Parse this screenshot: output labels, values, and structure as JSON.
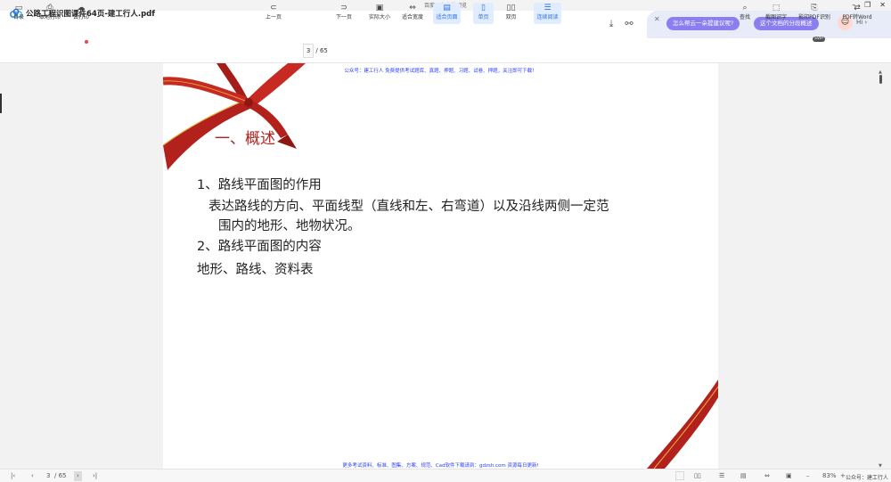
{
  "window": {
    "title": "百度网盘文档预览",
    "controls": [
      "–",
      "❐",
      "✕"
    ]
  },
  "header": {
    "doc_title": "公路工程识图课件64页-建工行人.pdf",
    "download_icon": "download-icon",
    "share_icon": "share-icon"
  },
  "ai": {
    "suggestions": [
      "怎么帮云一朵提建议呢?",
      "这个文档的分段概述"
    ],
    "greeting": "Hi ›"
  },
  "toolbar": {
    "left": [
      {
        "label": "目录",
        "icon": "▭"
      },
      {
        "label": "本地打印",
        "icon": "⎙"
      },
      {
        "label": "云打印",
        "icon": "☁"
      }
    ],
    "prev": "上一页",
    "next": "下一页",
    "page_current": "3",
    "page_total": "/ 65",
    "modes": [
      {
        "label": "实际大小",
        "icon": "▣"
      },
      {
        "label": "适合宽度",
        "icon": "⇔"
      },
      {
        "label": "适合页面",
        "icon": "▤"
      },
      {
        "label": "单页",
        "icon": "▯"
      },
      {
        "label": "双页",
        "icon": "▯▯"
      },
      {
        "label": "连续阅读",
        "icon": "☰"
      }
    ],
    "right": [
      {
        "label": "查找",
        "icon": "⌕"
      },
      {
        "label": "截图识字",
        "icon": "⬚"
      },
      {
        "label": "影印PDF识别",
        "icon": "⎘"
      },
      {
        "label": "PDF转Word",
        "icon": "⇄"
      }
    ],
    "svip_tag": "SVIP"
  },
  "page": {
    "public_notice_top": "公众号：建工行人 免费提供考试题库、真题、押题、习题、试卷、押题，关注即可下载！",
    "heading": "一、概述",
    "lines": [
      "1、路线平面图的作用",
      "表达路线的方向、平面线型（直线和左、右弯道）以及沿线两侧一定范",
      "围内的地形、地物状况。",
      "2、路线平面图的内容",
      "地形、路线、资料表"
    ],
    "public_notice_bottom": "更多考试资料、标准、图集、方案、规范、Cad软件下载请到：gdzsh.com 资源每日更新!"
  },
  "bottom": {
    "page_current": "3",
    "page_total": "/ 65",
    "zoom": "83%",
    "watermark": "公众号：建工行人"
  },
  "colors": {
    "accent": "#2f6fe8",
    "ribbon": "#b3211c",
    "ai_pill": "#8b7ef0",
    "notice_blue": "#2a3cff"
  }
}
